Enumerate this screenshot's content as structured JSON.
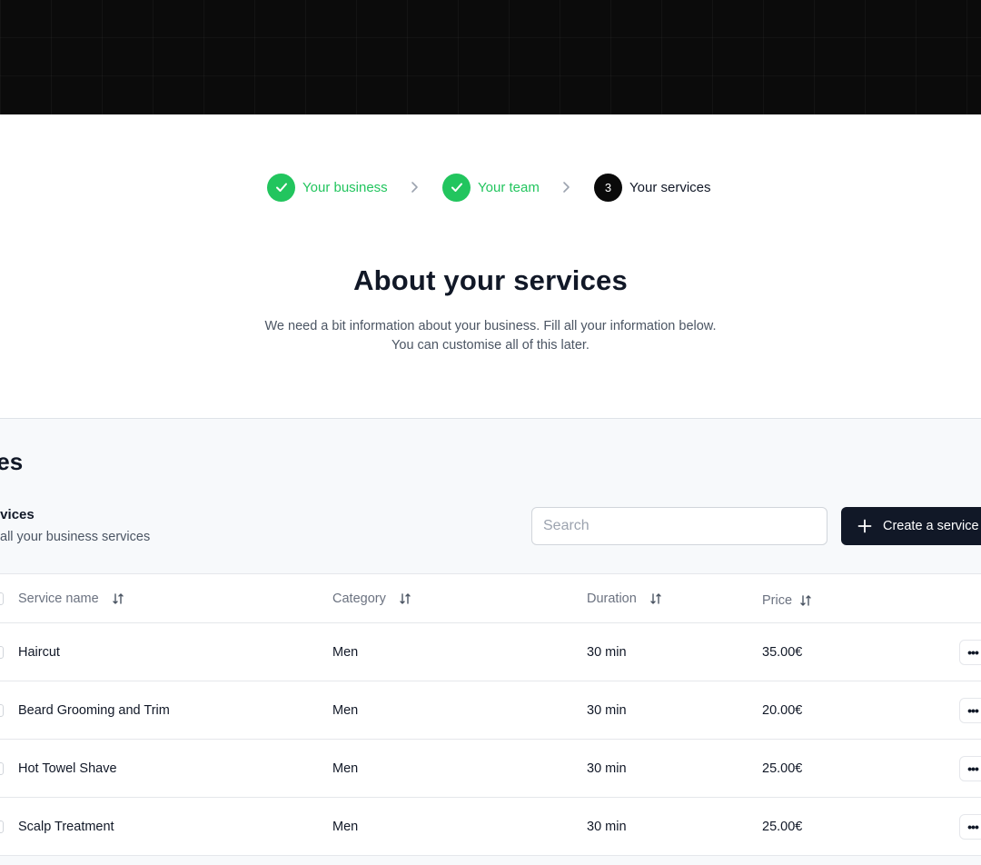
{
  "stepper": {
    "steps": [
      {
        "label": "Your business",
        "status": "done"
      },
      {
        "label": "Your team",
        "status": "done"
      },
      {
        "number": "3",
        "label": "Your services",
        "status": "current"
      }
    ]
  },
  "heading": {
    "title": "About your services",
    "subtitle_line1": "We need a bit information about your business. Fill all your information below.",
    "subtitle_line2": "You can customise all of this later."
  },
  "panel": {
    "title": "rvices",
    "section_title": "ervices",
    "section_desc": "all your business services",
    "search": {
      "placeholder": "Search",
      "value": ""
    },
    "create_button_label": "Create a service"
  },
  "table": {
    "columns": [
      "Service name",
      "Category",
      "Duration",
      "Price"
    ],
    "rows": [
      {
        "name": "Haircut",
        "category": "Men",
        "duration": "30 min",
        "price": "35.00€"
      },
      {
        "name": "Beard Grooming and Trim",
        "category": "Men",
        "duration": "30 min",
        "price": "20.00€"
      },
      {
        "name": "Hot Towel Shave",
        "category": "Men",
        "duration": "30 min",
        "price": "25.00€"
      },
      {
        "name": "Scalp Treatment",
        "category": "Men",
        "duration": "30 min",
        "price": "25.00€"
      }
    ],
    "row_action_label": "•••"
  },
  "colors": {
    "done_green": "#22c55e",
    "primary_dark": "#111827",
    "panel_bg": "#f7f9fb"
  },
  "icons": [
    "check-icon",
    "chevron-right-icon",
    "plus-icon",
    "sort-icon",
    "more-icon"
  ]
}
